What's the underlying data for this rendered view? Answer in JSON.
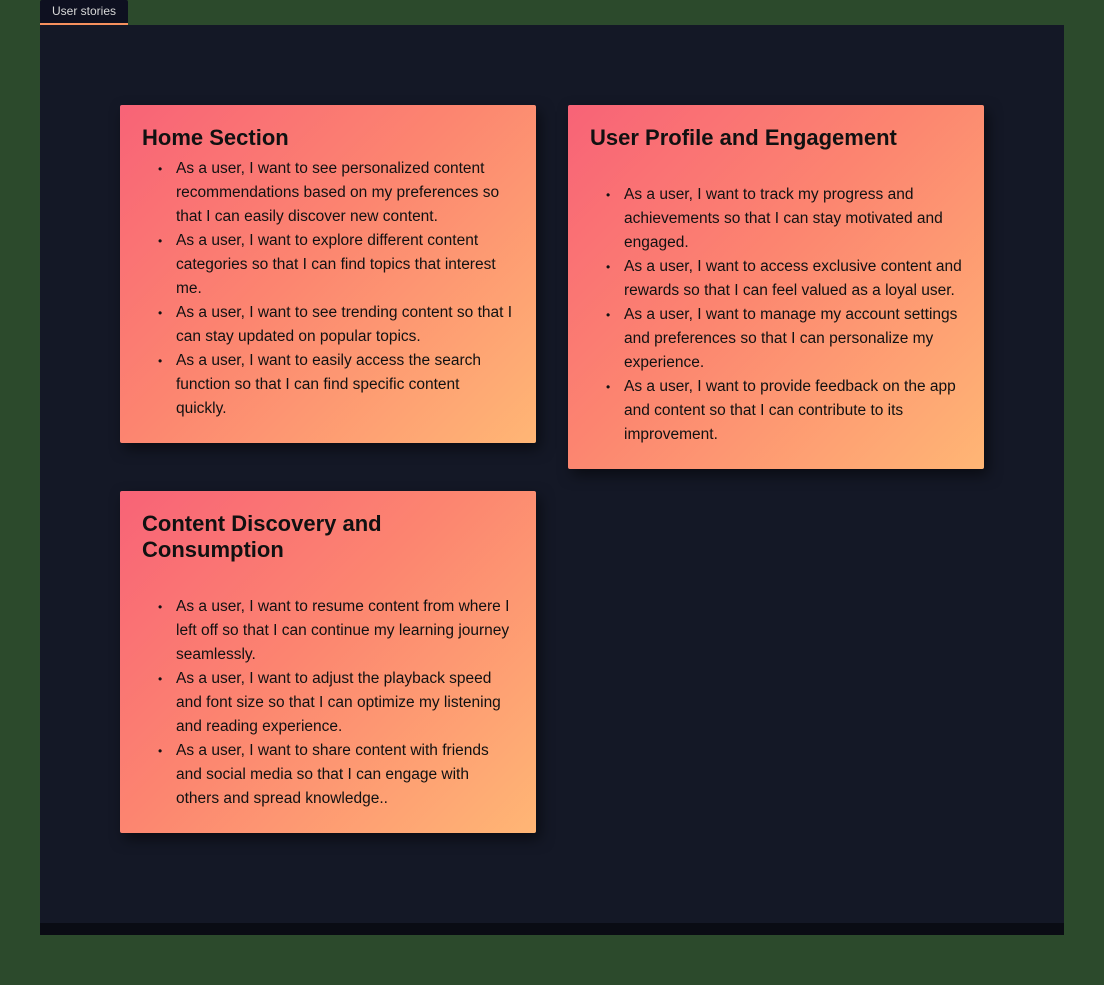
{
  "tab_label": "User stories",
  "cards": {
    "home": {
      "title": "Home Section",
      "items": [
        "As a user, I want to see personalized content recommendations based on my preferences so that I can easily discover new content.",
        "As a user, I want to explore different content categories so that I can find topics that interest me.",
        "As a user, I want to see trending content so that I can stay updated on popular topics.",
        "As a user, I want to easily access the search function so that I can find specific content quickly."
      ]
    },
    "discovery": {
      "title": "Content Discovery and Consumption",
      "items": [
        "As a user, I want to resume content from where I left off so that I can continue my learning journey seamlessly.",
        "As a user, I want to adjust the playback speed and font size so that I can optimize my listening and reading experience.",
        "As a user, I want to share content with friends and social media so that I can engage with others and spread knowledge.."
      ]
    },
    "profile": {
      "title": "User Profile and Engagement",
      "items": [
        "As a user, I want to track my progress and achievements so that I can stay motivated and engaged.",
        "As a user, I want to access exclusive content and rewards so that I can feel valued as a loyal user.",
        "As a user, I want to manage my account settings and preferences so that I can personalize my experience.",
        "As a user, I want to provide feedback on the app and content so that I can contribute to its improvement."
      ]
    }
  }
}
